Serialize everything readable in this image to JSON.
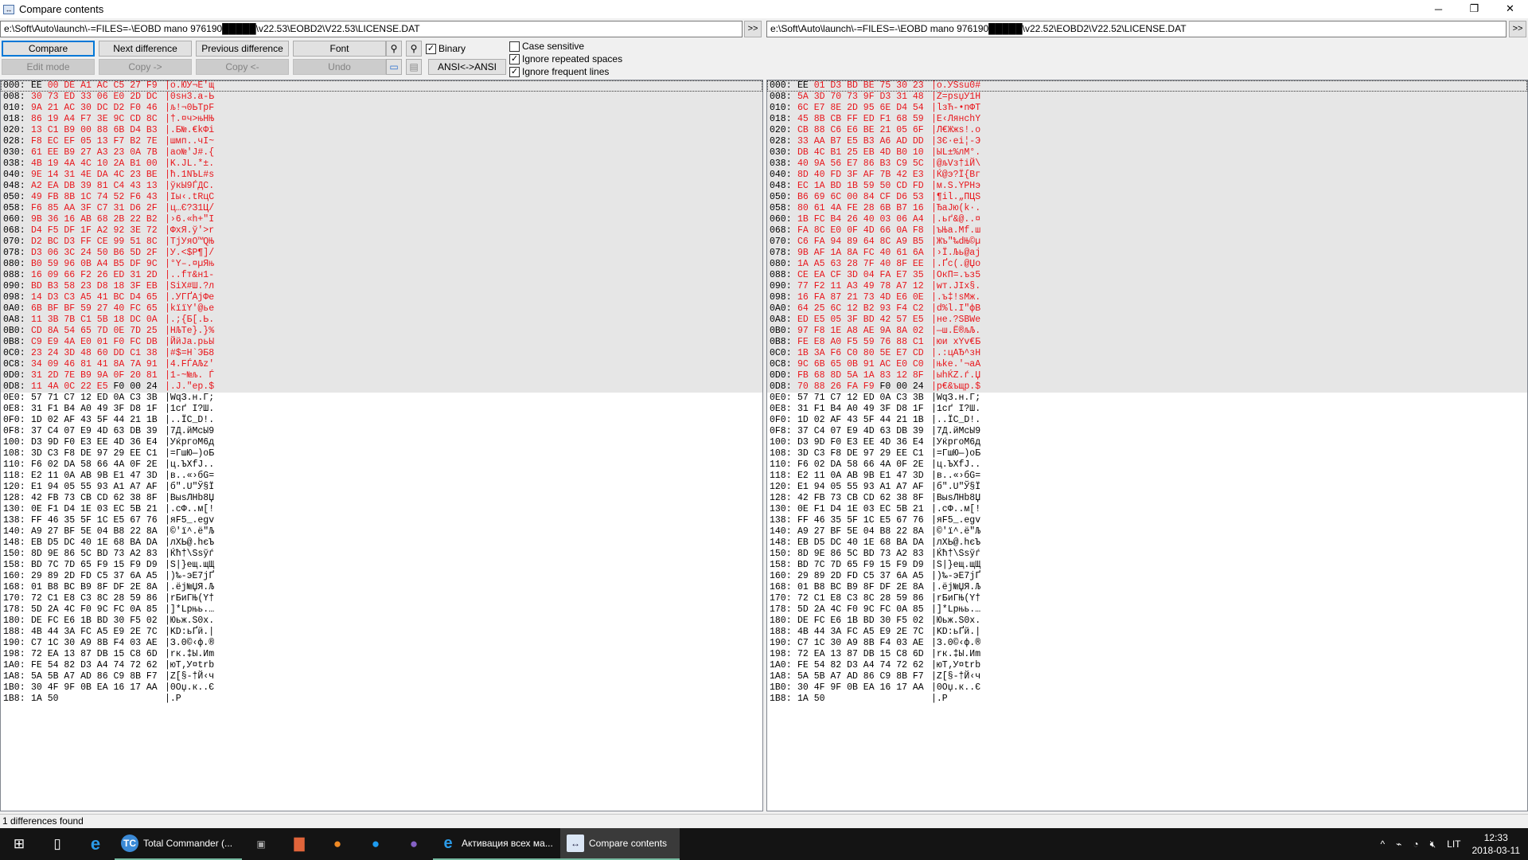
{
  "window": {
    "title": "Compare contents",
    "minimize": "─",
    "maximize": "❐",
    "close": "✕"
  },
  "paths": {
    "left": "e:\\Soft\\Auto\\launch\\-=FILES=-\\EOBD mano 976190█████\\v22.53\\EOBD2\\V22.53\\LICENSE.DAT",
    "right": "e:\\Soft\\Auto\\launch\\-=FILES=-\\EOBD mano 976190█████\\v22.52\\EOBD2\\V22.52\\LICENSE.DAT",
    "browse_label": ">>"
  },
  "toolbar": {
    "compare": "Compare",
    "next_diff": "Next difference",
    "prev_diff": "Previous difference",
    "font": "Font",
    "edit_mode": "Edit mode",
    "copy_right": "Copy ->",
    "copy_left": "Copy <-",
    "undo": "Undo",
    "ansi": "ANSI<->ANSI",
    "binary": {
      "label": "Binary",
      "checked": true
    },
    "case_sensitive": {
      "label": "Case sensitive",
      "checked": false
    },
    "ignore_spaces": {
      "label": "Ignore repeated spaces",
      "checked": true
    },
    "ignore_frequent": {
      "label": "Ignore frequent lines",
      "checked": true
    }
  },
  "colors": {
    "diff_text": "#e8161c",
    "diff_bg": "#e6e6e6",
    "accent": "#0078d7"
  },
  "left_diff_rows": [
    [
      "000",
      "EE 00 DE A1 AC C5 27 F9",
      "o.ЮЎ¬Е'щ",
      [
        0
      ]
    ],
    [
      "008",
      "30 73 ED 33 06 E0 2D DC",
      "0sн3.а-Ь",
      []
    ],
    [
      "010",
      "9A 21 AC 30 DC D2 F0 46",
      "љ!¬0ЬТрF",
      []
    ],
    [
      "018",
      "86 19 A4 F7 3E 9C CD 8C",
      "†.¤ч>њНЊ",
      []
    ],
    [
      "020",
      "13 C1 B9 00 88 6B D4 B3",
      ".Б№.€kФі",
      []
    ],
    [
      "028",
      "F8 EC EF 05 13 F7 B2 7E",
      "шмп..чІ~",
      []
    ],
    [
      "030",
      "61 EE B9 27 A3 23 0A 7B",
      "ao№'Ј#.{",
      []
    ],
    [
      "038",
      "4B 19 4A 4C 10 2A B1 00",
      "K.JL.*±.",
      []
    ],
    [
      "040",
      "9E 14 31 4E DA 4C 23 BE",
      "ћ.1NЪL#ѕ",
      []
    ],
    [
      "048",
      "A2 EA DB 39 81 C4 43 13",
      "ўкЫ9ЃДC.",
      []
    ],
    [
      "050",
      "49 FB 8B 1C 74 52 F6 43",
      "Iы‹.tRцC",
      []
    ],
    [
      "058",
      "F6 85 AA 3F C7 31 D6 2F",
      "ц…Є?З1Ц/",
      []
    ],
    [
      "060",
      "9B 36 16 AB 68 2B 22 B2",
      "›6.«h+\"І",
      []
    ],
    [
      "068",
      "D4 F5 DF 1F A2 92 3E 72",
      "ФхЯ.ў'>r",
      []
    ],
    [
      "070",
      "D2 BC D3 FF CE 99 51 8C",
      "ТјУяО™QЊ",
      []
    ],
    [
      "078",
      "D3 06 3C 24 50 B6 5D 2F",
      "У.<$P¶]/",
      []
    ],
    [
      "080",
      "B0 59 96 0B A4 B5 DF 9C",
      "°Y–.¤µЯњ",
      []
    ],
    [
      "088",
      "16 09 66 F2 26 ED 31 2D",
      "..fт&н1-",
      []
    ],
    [
      "090",
      "BD B3 58 23 D8 18 3F EB",
      "ЅіX#Ш.?л",
      []
    ],
    [
      "098",
      "14 D3 C3 A5 41 BC D4 65",
      ".УГҐAјФe",
      []
    ],
    [
      "0A0",
      "6B BF BF 59 27 40 FC 65",
      "kїїY'@ьe",
      []
    ],
    [
      "0A8",
      "11 3B 7B C1 5B 18 DC 0A",
      ".;{Б[.Ь.",
      []
    ],
    [
      "0B0",
      "CD 8A 54 65 7D 0E 7D 25",
      "НЉTe}.}%",
      []
    ],
    [
      "0B8",
      "C9 E9 4A E0 01 F0 FC DB",
      "ЙйJа.рьЫ",
      []
    ],
    [
      "0C0",
      "23 24 3D 48 60 DD C1 38",
      "#$=H`ЭБ8",
      []
    ],
    [
      "0C8",
      "34 09 46 81 41 8A 7A 91",
      "4.FЃAЉz'",
      []
    ],
    [
      "0D0",
      "31 2D 7E B9 9A 0F 20 81",
      "1-~№љ. Ѓ",
      []
    ],
    [
      "0D8",
      "11 4A 0C 22 E5 F0 00 24",
      ".J.\"ер.$",
      [
        5,
        6,
        7
      ]
    ]
  ],
  "right_diff_rows": [
    [
      "000",
      "EE 01 D3 BD BE 75 30 23",
      "o.УЅѕu0#",
      [
        0
      ]
    ],
    [
      "008",
      "5A 3D 70 73 9F D3 31 48",
      "Z=psџУ1H",
      []
    ],
    [
      "010",
      "6C E7 8E 2D 95 6E D4 54",
      "lзЋ-•nФT",
      []
    ],
    [
      "018",
      "45 8B CB FF ED F1 68 59",
      "E‹ЛянсhY",
      []
    ],
    [
      "020",
      "CB 88 C6 E6 BE 21 05 6F",
      "Л€Жжѕ!.o",
      []
    ],
    [
      "028",
      "33 AA B7 E5 B3 A6 AD DD",
      "3Є·еі¦-Э",
      []
    ],
    [
      "030",
      "DB 4C B1 25 EB 4D B0 10",
      "ЫL±%лM°.",
      []
    ],
    [
      "038",
      "40 9A 56 E7 86 B3 C9 5C",
      "@љVз†іЙ\\",
      []
    ],
    [
      "040",
      "8D 40 FD 3F AF 7B 42 E3",
      "Ќ@э?Ї{Bг",
      []
    ],
    [
      "048",
      "EC 1A BD 1B 59 50 CD FD",
      "м.Ѕ.YPНэ",
      []
    ],
    [
      "050",
      "B6 69 6C 00 84 CF D6 53",
      "¶il.„ПЦS",
      []
    ],
    [
      "058",
      "80 61 4A FE 28 6B B7 16",
      "ЂaJю(k·.",
      []
    ],
    [
      "060",
      "1B FC B4 26 40 03 06 A4",
      ".ьґ&@..¤",
      []
    ],
    [
      "068",
      "FA 8C E0 0F 4D 66 0A F8",
      "ъЊа.Mf.ш",
      []
    ],
    [
      "070",
      "C6 FA 94 89 64 8C A9 B5",
      "Жъ\"‰dЊ©µ",
      []
    ],
    [
      "078",
      "9B AF 1A 8A FC 40 61 6A",
      "›Ї.Љь@aj",
      []
    ],
    [
      "080",
      "1A A5 63 28 7F 40 8F EE",
      ".Ґc(.@Џо",
      []
    ],
    [
      "088",
      "CE EA CF 3D 04 FA E7 35",
      "ОкП=.ъз5",
      []
    ],
    [
      "090",
      "77 F2 11 A3 49 78 A7 12",
      "wт.ЈIx§.",
      []
    ],
    [
      "098",
      "16 FA 87 21 73 4D E6 0E",
      ".ъ‡!sMж.",
      []
    ],
    [
      "0A0",
      "64 25 6C 12 B2 93 F4 C2",
      "d%l.І\"фВ",
      []
    ],
    [
      "0A8",
      "ED E5 05 3F BD 42 57 E5",
      "не.?ЅBWе",
      []
    ],
    [
      "0B0",
      "97 F8 1E A8 AE 9A 8A 02",
      "—ш.Ё®љЉ.",
      []
    ],
    [
      "0B8",
      "FE E8 A0 F5 59 76 88 C1",
      "юи хYv€Б",
      []
    ],
    [
      "0C0",
      "1B 3A F6 C0 80 5E E7 CD",
      ".:цАЂ^зН",
      []
    ],
    [
      "0C8",
      "9C 6B 65 0B 91 AC E0 C0",
      "њke.'¬аА",
      []
    ],
    [
      "0D0",
      "FB 68 8D 5A 1A 83 12 8F",
      "ыhЌZ.ѓ.Џ",
      []
    ],
    [
      "0D8",
      "70 88 26 FA F9 F0 00 24",
      "p€&ъщр.$",
      [
        5,
        6,
        7
      ]
    ]
  ],
  "common_rows": [
    [
      "0E0",
      "57 71 C7 12 ED 0A C3 3B",
      "WqЗ.н.Г;"
    ],
    [
      "0E8",
      "31 F1 B4 A0 49 3F D8 1F",
      "1сґ I?Ш."
    ],
    [
      "0F0",
      "1D 02 AF 43 5F 44 21 1B",
      "..ЇC_D!."
    ],
    [
      "0F8",
      "37 C4 07 E9 4D 63 DB 39",
      "7Д.йMcЫ9"
    ],
    [
      "100",
      "D3 9D F0 E3 EE 4D 36 E4",
      "УќргоM6д"
    ],
    [
      "108",
      "3D C3 F8 DE 97 29 EE C1",
      "=ГшЮ—)оБ"
    ],
    [
      "110",
      "F6 02 DA 58 66 4A 0F 2E",
      "ц.ЪXfJ.."
    ],
    [
      "118",
      "E2 11 0A AB 9B E1 47 3D",
      "в..«›бG="
    ],
    [
      "120",
      "E1 94 05 55 93 A1 A7 AF",
      "б\".U\"Ў§Ї"
    ],
    [
      "128",
      "42 FB 73 CB CD 62 38 8F",
      "BыsЛНb8Џ"
    ],
    [
      "130",
      "0E F1 D4 1E 03 EC 5B 21",
      ".сФ..м[!"
    ],
    [
      "138",
      "FF 46 35 5F 1C E5 67 76",
      "яF5_.еgv"
    ],
    [
      "140",
      "A9 27 BF 5E 04 B8 22 8A",
      "©'ї^.ё\"Љ"
    ],
    [
      "148",
      "EB D5 DC 40 1E 68 BA DA",
      "лХЬ@.hєЪ"
    ],
    [
      "150",
      "8D 9E 86 5C BD 73 A2 83",
      "Ќћ†\\Ѕsўѓ"
    ],
    [
      "158",
      "BD 7C 7D 65 F9 15 F9 D9",
      "Ѕ|}eщ.щЩ"
    ],
    [
      "160",
      "29 89 2D FD C5 37 6A A5",
      ")‰-эЕ7jҐ"
    ],
    [
      "168",
      "01 B8 BC B9 8F DF 2E 8A",
      ".ёј№ЏЯ.Љ"
    ],
    [
      "170",
      "72 C1 E8 C3 8C 28 59 86",
      "rБиГЊ(Y†"
    ],
    [
      "178",
      "5D 2A 4C F0 9C FC 0A 85",
      "]*Lрњь.…"
    ],
    [
      "180",
      "DE FC E6 1B BD 30 F5 02",
      "Юьж.Ѕ0х."
    ],
    [
      "188",
      "4B 44 3A FC A5 E9 2E 7C",
      "KD:ьҐй.|"
    ],
    [
      "190",
      "C7 1C 30 A9 8B F4 03 AE",
      "З.0©‹ф.®"
    ],
    [
      "198",
      "72 EA 13 87 DB 15 C8 6D",
      "rк.‡Ы.Иm"
    ],
    [
      "1A0",
      "FE 54 82 D3 A4 74 72 62",
      "юT‚У¤trb"
    ],
    [
      "1A8",
      "5A 5B A7 AD 86 C9 8B F7",
      "Z[§-†Й‹ч"
    ],
    [
      "1B0",
      "30 4F 9F 0B EA 16 17 AA",
      "0Oџ.к..Є"
    ],
    [
      "1B8",
      "1A 50",
      ".P"
    ]
  ],
  "status": "1 differences found",
  "taskbar": {
    "apps": [
      {
        "label": "Total Commander (...",
        "icon": "total-commander-icon"
      },
      {
        "label": "Активация всех ма...",
        "icon": "internet-explorer-icon"
      },
      {
        "label": "Compare contents",
        "icon": "compare-icon",
        "active": true
      }
    ],
    "tray": {
      "language": "LIT",
      "time": "12:33",
      "date": "2018-03-11"
    }
  }
}
